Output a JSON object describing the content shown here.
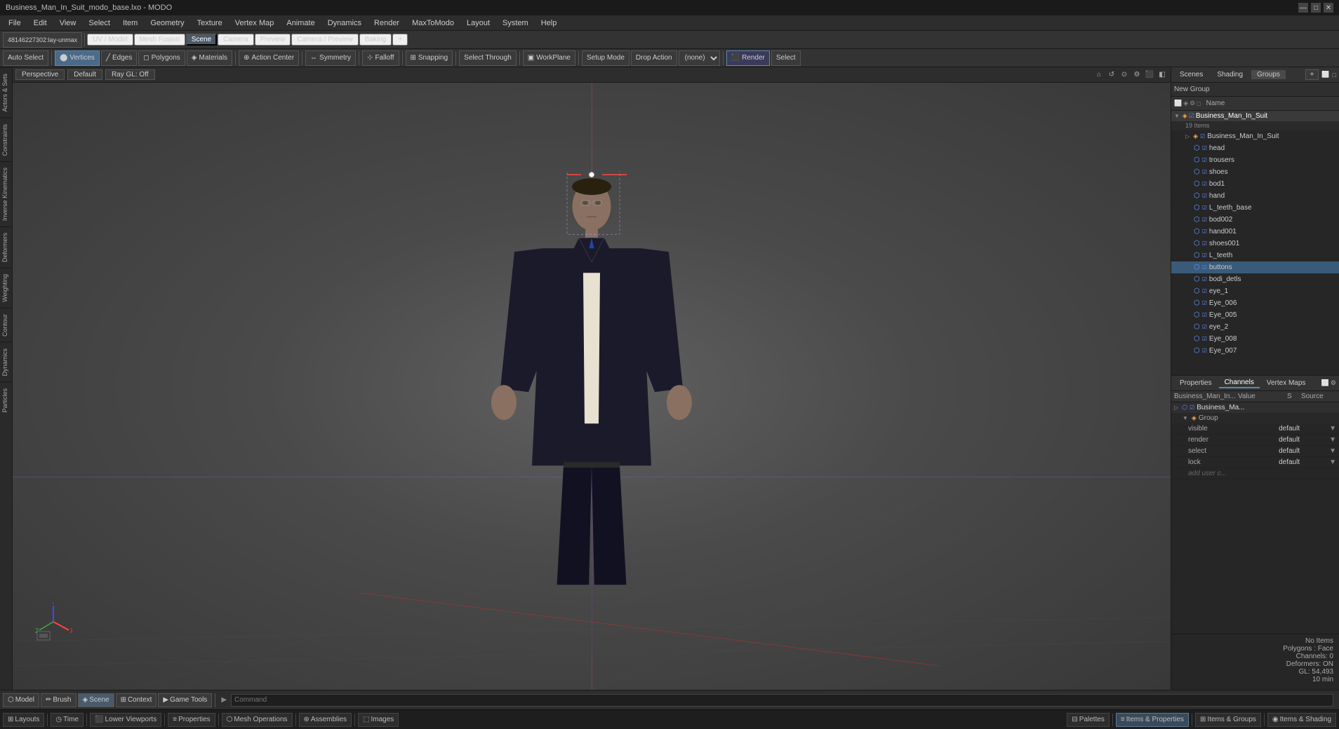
{
  "titlebar": {
    "title": "Business_Man_In_Suit_modo_base.lxo - MODO",
    "min_label": "—",
    "max_label": "□",
    "close_label": "✕"
  },
  "menubar": {
    "items": [
      "File",
      "Edit",
      "View",
      "Select",
      "Item",
      "Geometry",
      "Texture",
      "Vertex Map",
      "Animate",
      "Dynamics",
      "Render",
      "MaxToModo",
      "Layout",
      "System",
      "Help"
    ]
  },
  "toolbar": {
    "file_info": "48146227302:lay-unmax",
    "uv_label": "UV / Model",
    "mesh_fusion_label": "Mesh Fusion",
    "scene_label": "Scene",
    "camera_label": "Camera",
    "preview_label": "Preview",
    "camera_preview_label": "Camera / Preview",
    "baking_label": "Baking",
    "add_label": "+",
    "auto_select_label": "Auto Select",
    "vertices_label": "Vertices",
    "edges_label": "Edges",
    "polygons_label": "Polygons",
    "materials_label": "Materials",
    "action_center_label": "Action Center",
    "symmetry_label": "Symmetry",
    "falloff_label": "Falloff",
    "snapping_label": "Snapping",
    "select_through_label": "Select Through",
    "workplane_label": "WorkPlane",
    "setup_mode_label": "Setup Mode",
    "drop_action_label": "Drop Action",
    "none_label": "(none)",
    "render_label": "Render",
    "select_label": "Select"
  },
  "viewport": {
    "perspective_label": "Perspective",
    "default_label": "Default",
    "ray_gl_label": "Ray GL: Off",
    "tabs": [
      "Model",
      "UV / Model",
      "Mesh Fusion",
      "Scene",
      "Camera",
      "Preview",
      "Camera / Preview",
      "Baking"
    ],
    "active_tab": "Scene"
  },
  "left_sidebar": {
    "tabs": [
      "Actors & Sets",
      "Constraints",
      "Inverse Kinematics",
      "Deformers",
      "Weighting",
      "Contour",
      "Dynamics",
      "Particles"
    ]
  },
  "scene_tree": {
    "title": "New Group",
    "panel_tabs": [
      "Scenes",
      "Shading",
      "Groups"
    ],
    "active_tab": "Groups",
    "add_button": "+",
    "header_col": "Name",
    "root_item": "Business_Man_In_Suit",
    "item_count": "19 Items",
    "items": [
      {
        "name": "Business_Man_In_Suit",
        "type": "group",
        "indent": 0
      },
      {
        "name": "head",
        "type": "mesh",
        "indent": 1
      },
      {
        "name": "trousers",
        "type": "mesh",
        "indent": 1
      },
      {
        "name": "shoes",
        "type": "mesh",
        "indent": 1
      },
      {
        "name": "bod1",
        "type": "mesh",
        "indent": 1
      },
      {
        "name": "hand",
        "type": "mesh",
        "indent": 1
      },
      {
        "name": "L_teeth_base",
        "type": "mesh",
        "indent": 1
      },
      {
        "name": "bod002",
        "type": "mesh",
        "indent": 1
      },
      {
        "name": "hand001",
        "type": "mesh",
        "indent": 1
      },
      {
        "name": "shoes001",
        "type": "mesh",
        "indent": 1
      },
      {
        "name": "L_teeth",
        "type": "mesh",
        "indent": 1
      },
      {
        "name": "buttons",
        "type": "mesh",
        "indent": 1
      },
      {
        "name": "bodi_detls",
        "type": "mesh",
        "indent": 1
      },
      {
        "name": "eye_1",
        "type": "mesh",
        "indent": 1
      },
      {
        "name": "Eye_006",
        "type": "mesh",
        "indent": 1
      },
      {
        "name": "Eye_005",
        "type": "mesh",
        "indent": 1
      },
      {
        "name": "eye_2",
        "type": "mesh",
        "indent": 1
      },
      {
        "name": "Eye_008",
        "type": "mesh",
        "indent": 1
      },
      {
        "name": "Eye_007",
        "type": "mesh",
        "indent": 1
      }
    ]
  },
  "properties_panel": {
    "tabs": [
      "Properties",
      "Channels",
      "Vertex Maps"
    ],
    "active_tab": "Channels",
    "col_name": "Business_Man_In...",
    "col_value": "Value",
    "col_s": "S",
    "col_source": "Source",
    "root_item": "Business_Ma...",
    "group_item": "Group",
    "rows": [
      {
        "name": "visible",
        "value": "default"
      },
      {
        "name": "render",
        "value": "default"
      },
      {
        "name": "select",
        "value": "default"
      },
      {
        "name": "lock",
        "value": "default"
      }
    ],
    "add_user_label": "add user c..."
  },
  "info": {
    "no_items": "No Items",
    "polygons_face": "Polygons : Face",
    "channels": "Channels: 0",
    "deformers": "Deformers: ON",
    "gl": "GL: 54,493",
    "min": "10 min"
  },
  "command_bar": {
    "label": "Command",
    "placeholder": "Command"
  },
  "bottom_toolbar": {
    "buttons": [
      "Model",
      "Brush",
      "Scene",
      "Context",
      "Game Tools"
    ]
  },
  "statusbar": {
    "left_buttons": [
      "Layouts",
      "Time",
      "Lower Viewports",
      "Properties",
      "Mesh Operations",
      "Assemblies",
      "Images"
    ],
    "right_buttons": [
      "Palettes",
      "Items & Properties",
      "Items & Groups",
      "Items & Shading"
    ]
  },
  "axes": {
    "x_color": "#ff4444",
    "y_color": "#4444ff",
    "z_color": "#44ff44"
  }
}
